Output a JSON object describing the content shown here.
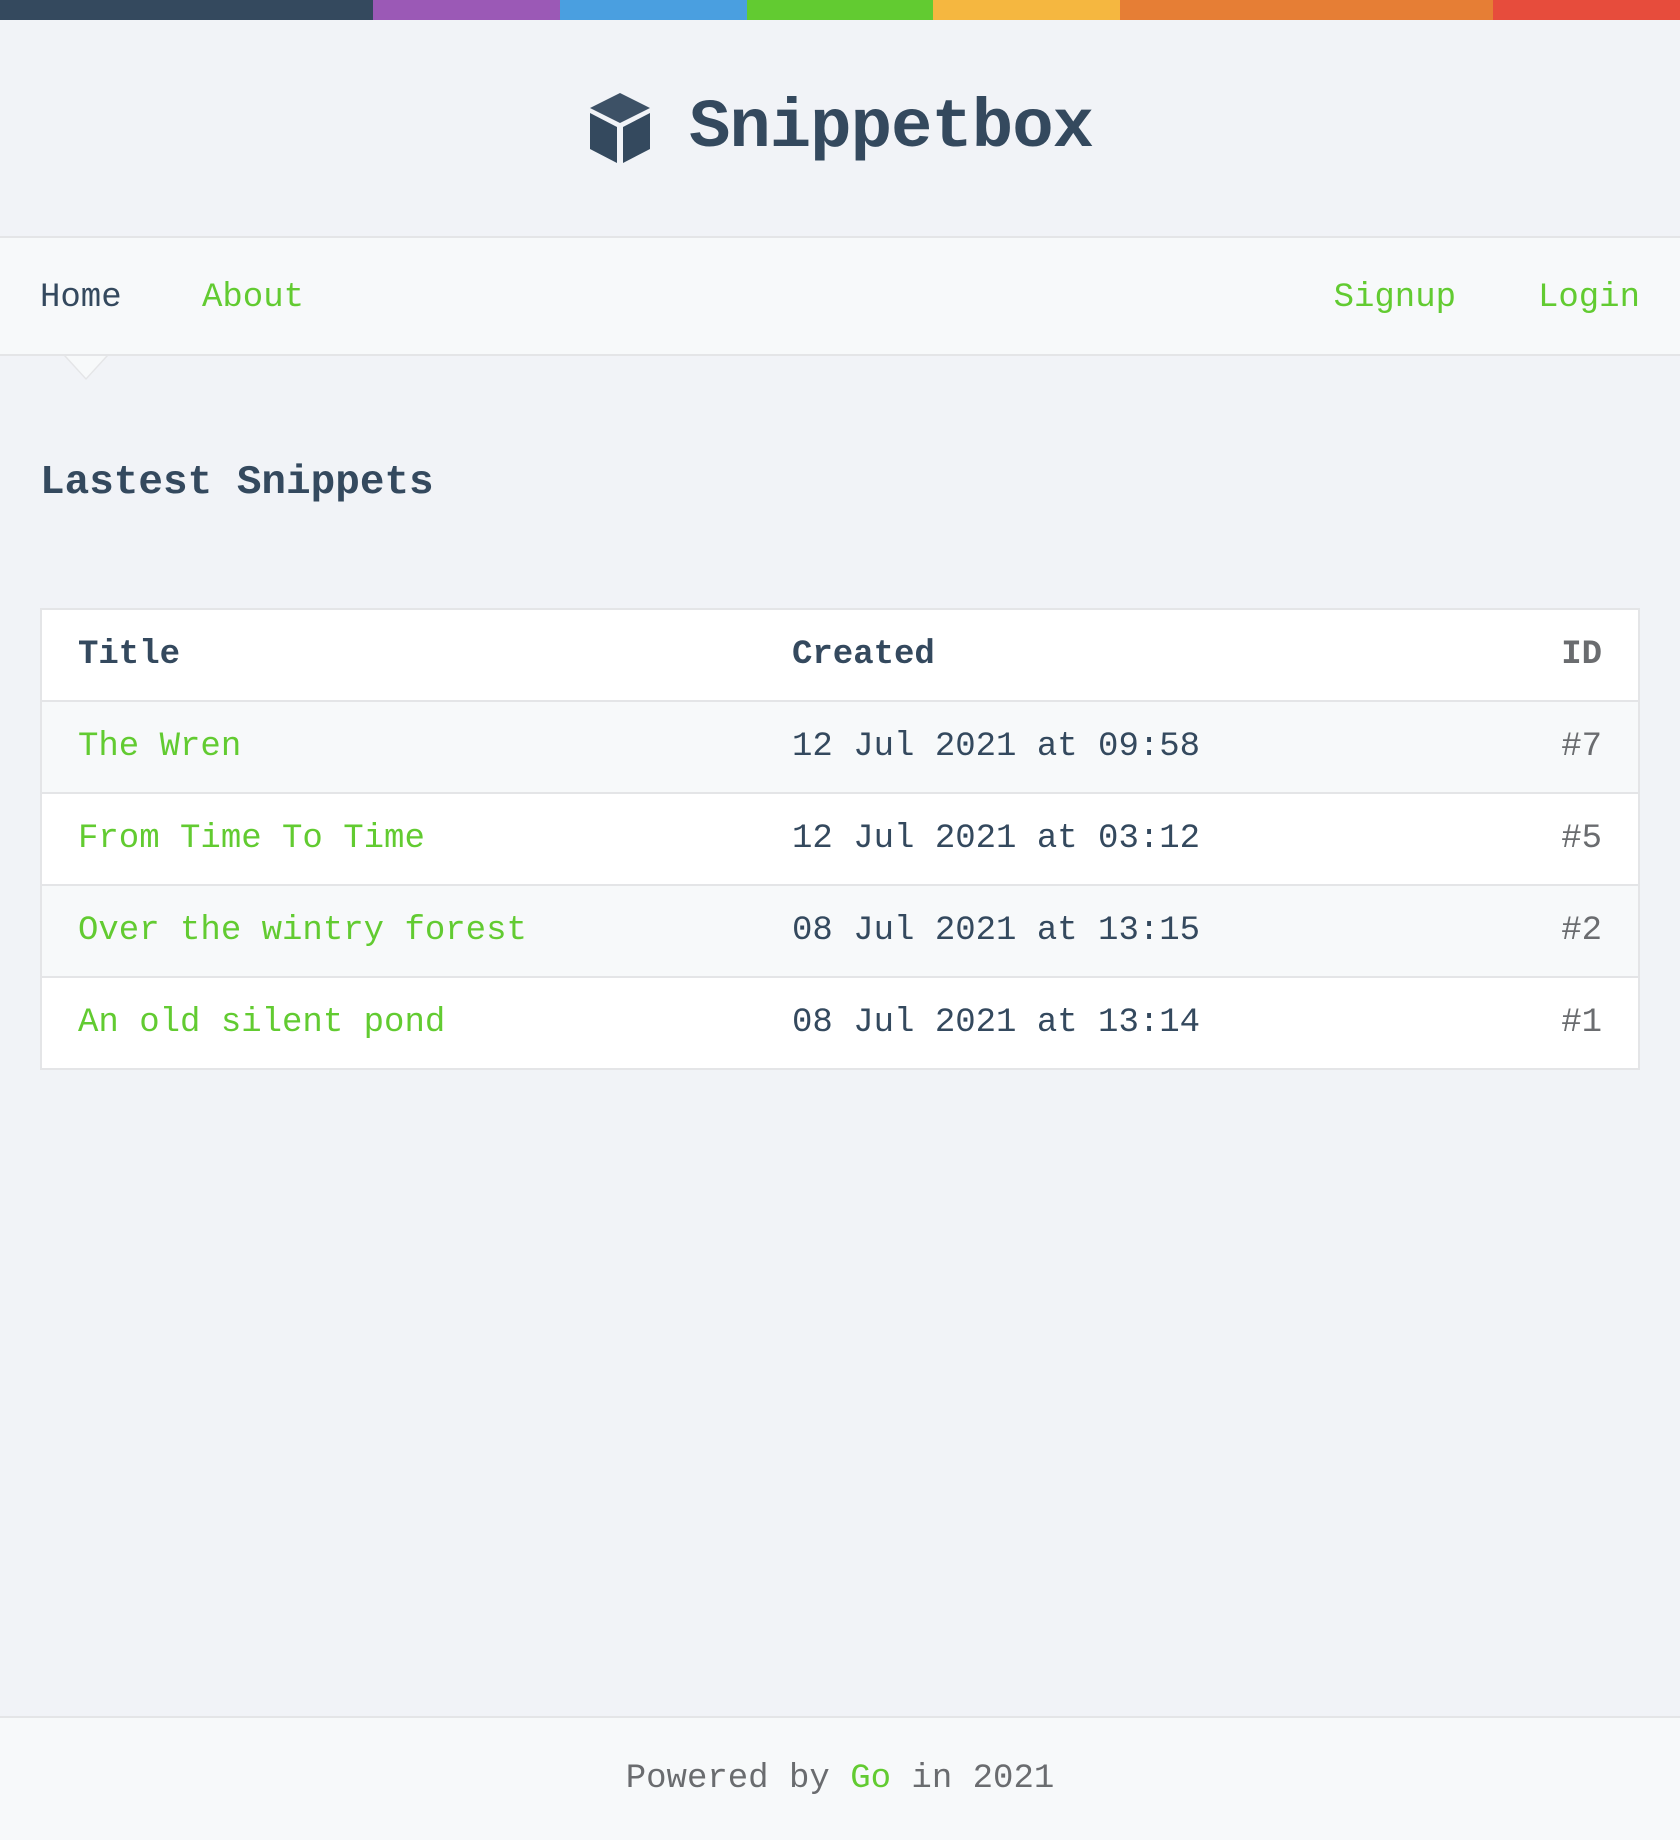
{
  "app": {
    "title": "Snippetbox",
    "logo_icon": "cube-icon",
    "stripe_colors": [
      "#34495e",
      "#34495e",
      "#9b59b6",
      "#4a9fe0",
      "#62cb31",
      "#f5b740",
      "#e67e35",
      "#e67e35",
      "#e74c3c"
    ]
  },
  "nav": {
    "home_label": "Home",
    "about_label": "About",
    "signup_label": "Signup",
    "login_label": "Login"
  },
  "main": {
    "heading": "Lastest Snippets",
    "table": {
      "headers": {
        "title": "Title",
        "created": "Created",
        "id": "ID"
      },
      "rows": [
        {
          "title": "The Wren",
          "created": "12 Jul 2021 at 09:58",
          "id": "#7"
        },
        {
          "title": "From Time To Time",
          "created": "12 Jul 2021 at 03:12",
          "id": "#5"
        },
        {
          "title": "Over the wintry forest",
          "created": "08 Jul 2021 at 13:15",
          "id": "#2"
        },
        {
          "title": "An old silent pond",
          "created": "08 Jul 2021 at 13:14",
          "id": "#1"
        }
      ]
    }
  },
  "footer": {
    "prefix": "Powered by",
    "link": "Go",
    "suffix": "in 2021"
  },
  "colors": {
    "accent": "#62cb31",
    "text": "#34495e",
    "muted": "#6a6c6f",
    "background": "#f1f3f7"
  }
}
